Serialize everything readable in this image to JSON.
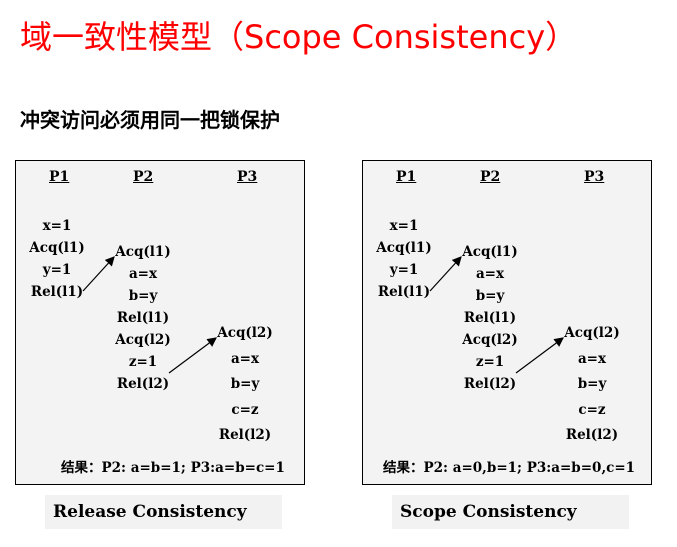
{
  "title": "域一致性模型（Scope Consistency）",
  "subtitle": "冲突访问必须用同一把锁保护",
  "panels": [
    {
      "headers": [
        "P1",
        "P2",
        "P3"
      ],
      "p1": [
        "x=1",
        "Acq(l1)",
        "y=1",
        "Rel(l1)"
      ],
      "p2": [
        "Acq(l1)",
        "a=x",
        "b=y",
        "Rel(l1)",
        "Acq(l2)",
        "z=1",
        "Rel(l2)"
      ],
      "p3": [
        "Acq(l2)",
        "a=x",
        "b=y",
        "c=z",
        "Rel(l2)"
      ],
      "result_label": "结果：",
      "result_value": "P2: a=b=1; P3:a=b=c=1",
      "caption": "Release Consistency"
    },
    {
      "headers": [
        "P1",
        "P2",
        "P3"
      ],
      "p1": [
        "x=1",
        "Acq(l1)",
        "y=1",
        "Rel(l1)"
      ],
      "p2": [
        "Acq(l1)",
        "a=x",
        "b=y",
        "Rel(l1)",
        "Acq(l2)",
        "z=1",
        "Rel(l2)"
      ],
      "p3": [
        "Acq(l2)",
        "a=x",
        "b=y",
        "c=z",
        "Rel(l2)"
      ],
      "result_label": "结果：",
      "result_value": "P2: a=0,b=1; P3:a=b=0,c=1",
      "caption": "Scope Consistency"
    }
  ]
}
